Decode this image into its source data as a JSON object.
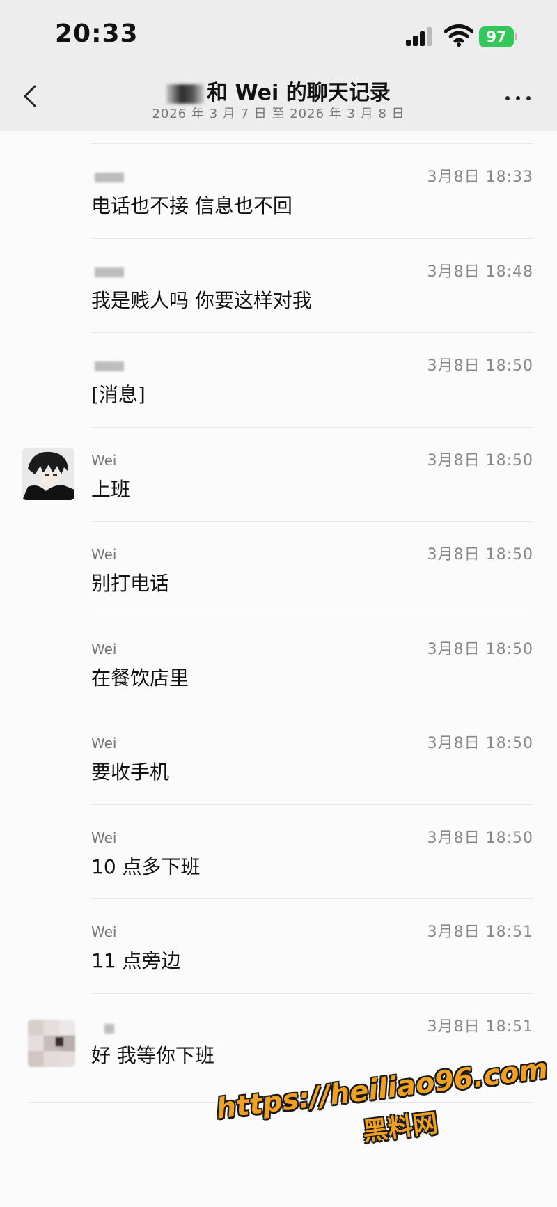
{
  "status_bar": {
    "time": "20:33",
    "battery": "97"
  },
  "nav": {
    "title_suffix": "和 Wei 的聊天记录",
    "subtitle": "2026 年 3 月 7 日 至 2026 年 3 月 8 日"
  },
  "messages": [
    {
      "sender": "",
      "time": "3月8日 18:33",
      "text": "电话也不接 信息也不回"
    },
    {
      "sender": "",
      "time": "3月8日 18:48",
      "text": "我是贱人吗 你要这样对我"
    },
    {
      "sender": "",
      "time": "3月8日 18:50",
      "text": "[消息]"
    },
    {
      "sender": "Wei",
      "time": "3月8日 18:50",
      "text": "上班"
    },
    {
      "sender": "Wei",
      "time": "3月8日 18:50",
      "text": "别打电话"
    },
    {
      "sender": "Wei",
      "time": "3月8日 18:50",
      "text": "在餐饮店里"
    },
    {
      "sender": "Wei",
      "time": "3月8日 18:50",
      "text": "要收手机"
    },
    {
      "sender": "Wei",
      "time": "3月8日 18:50",
      "text": "10 点多下班"
    },
    {
      "sender": "Wei",
      "time": "3月8日 18:51",
      "text": "11 点旁边"
    },
    {
      "sender": "",
      "time": "3月8日 18:51",
      "text": "好 我等你下班"
    }
  ],
  "watermark": {
    "url": "https://heiliao96.com",
    "name": "黑料网"
  }
}
